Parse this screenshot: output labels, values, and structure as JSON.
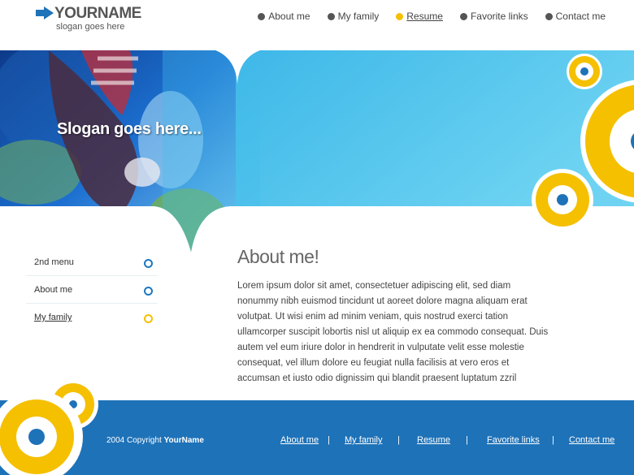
{
  "header": {
    "logo_name": "YOURNAME",
    "logo_slogan": "slogan goes here",
    "nav": [
      {
        "label": "About me",
        "active": false
      },
      {
        "label": "My family",
        "active": false
      },
      {
        "label": "Resume",
        "active": true
      },
      {
        "label": "Favorite links",
        "active": false
      },
      {
        "label": "Contact me",
        "active": false
      }
    ]
  },
  "hero": {
    "slogan": "Slogan goes here..."
  },
  "sidemenu": {
    "items": [
      {
        "label": "2nd menu",
        "active": false
      },
      {
        "label": "About me",
        "active": false
      },
      {
        "label": "My family",
        "active": true
      }
    ]
  },
  "main": {
    "title": "About me!",
    "body": "Lorem ipsum dolor sit amet, consectetuer adipiscing elit, sed diam nonummy nibh euismod tincidunt ut aoreet dolore magna aliquam erat volutpat. Ut wisi enim ad minim veniam, quis nostrud exerci tation ullamcorper suscipit lobortis nisl ut aliquip ex ea commodo consequat. Duis autem vel eum iriure dolor in hendrerit in vulputate velit esse molestie consequat, vel illum dolore eu feugiat nulla facilisis at vero eros et accumsan et iusto odio dignissim qui blandit praesent luptatum zzril"
  },
  "footer": {
    "copyright_prefix": "2004 Copyright ",
    "copyright_name": "YourName",
    "nav": [
      "About me",
      "My family",
      "Resume",
      "Favorite links",
      "Contact me"
    ],
    "separator": "|"
  },
  "colors": {
    "accent_blue": "#1e72b8",
    "accent_yellow": "#f5c000",
    "sky": "#4fc4ec"
  },
  "icons": {
    "logo": "arrow-right-icon",
    "nav_bullet": "dot-icon",
    "menu_marker": "ring-icon"
  }
}
